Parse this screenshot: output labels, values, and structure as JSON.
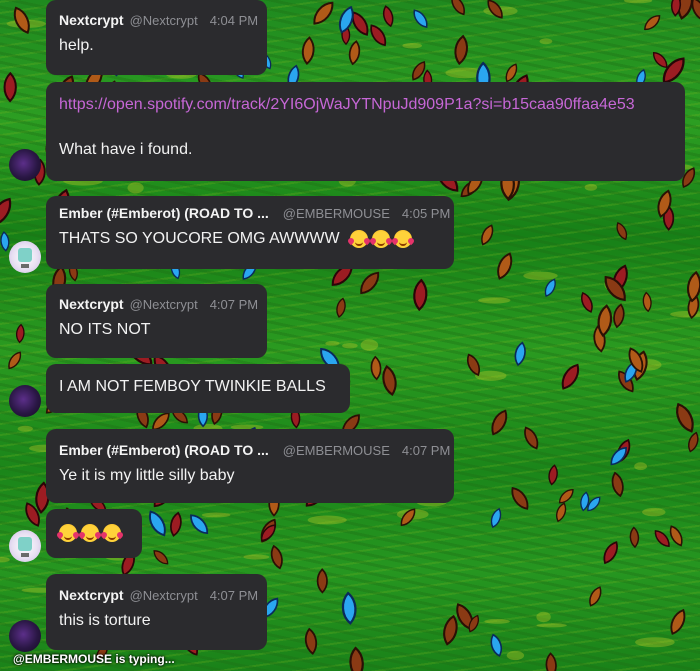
{
  "messages": [
    {
      "author": "Nextcrypt",
      "handle": "@Nextcrypt",
      "time": "4:04 PM",
      "text": "help."
    },
    {
      "link": "https://open.spotify.com/track/2YI6OjWaJYTNpuJd909P1a?si=b15caa90ffaa4e53",
      "text": "What have i found."
    },
    {
      "author": "Ember (#Emberot) (ROAD TO ...",
      "handle": "@EMBERMOUSE",
      "time": "4:05 PM",
      "text": "THATS SO YOUCORE OMG AWWWW"
    },
    {
      "author": "Nextcrypt",
      "handle": "@Nextcrypt",
      "time": "4:07 PM",
      "text": "NO ITS NOT"
    },
    {
      "text": "I AM NOT FEMBOY TWINKIE BALLS"
    },
    {
      "author": "Ember (#Emberot) (ROAD TO ...",
      "handle": "@EMBERMOUSE",
      "time": "4:07 PM",
      "text": "Ye it is my little silly baby"
    },
    {
      "emoji_only": true
    },
    {
      "author": "Nextcrypt",
      "handle": "@Nextcrypt",
      "time": "4:07 PM",
      "text": "this is torture"
    }
  ],
  "emoji_name": "smiling-face-with-hearts",
  "typing_indicator": "@EMBERMOUSE is typing...",
  "colors": {
    "bubble": "#2b2b2e",
    "link": "#c667d6",
    "muted": "#8e8f94",
    "background": "#1f8a1f"
  }
}
